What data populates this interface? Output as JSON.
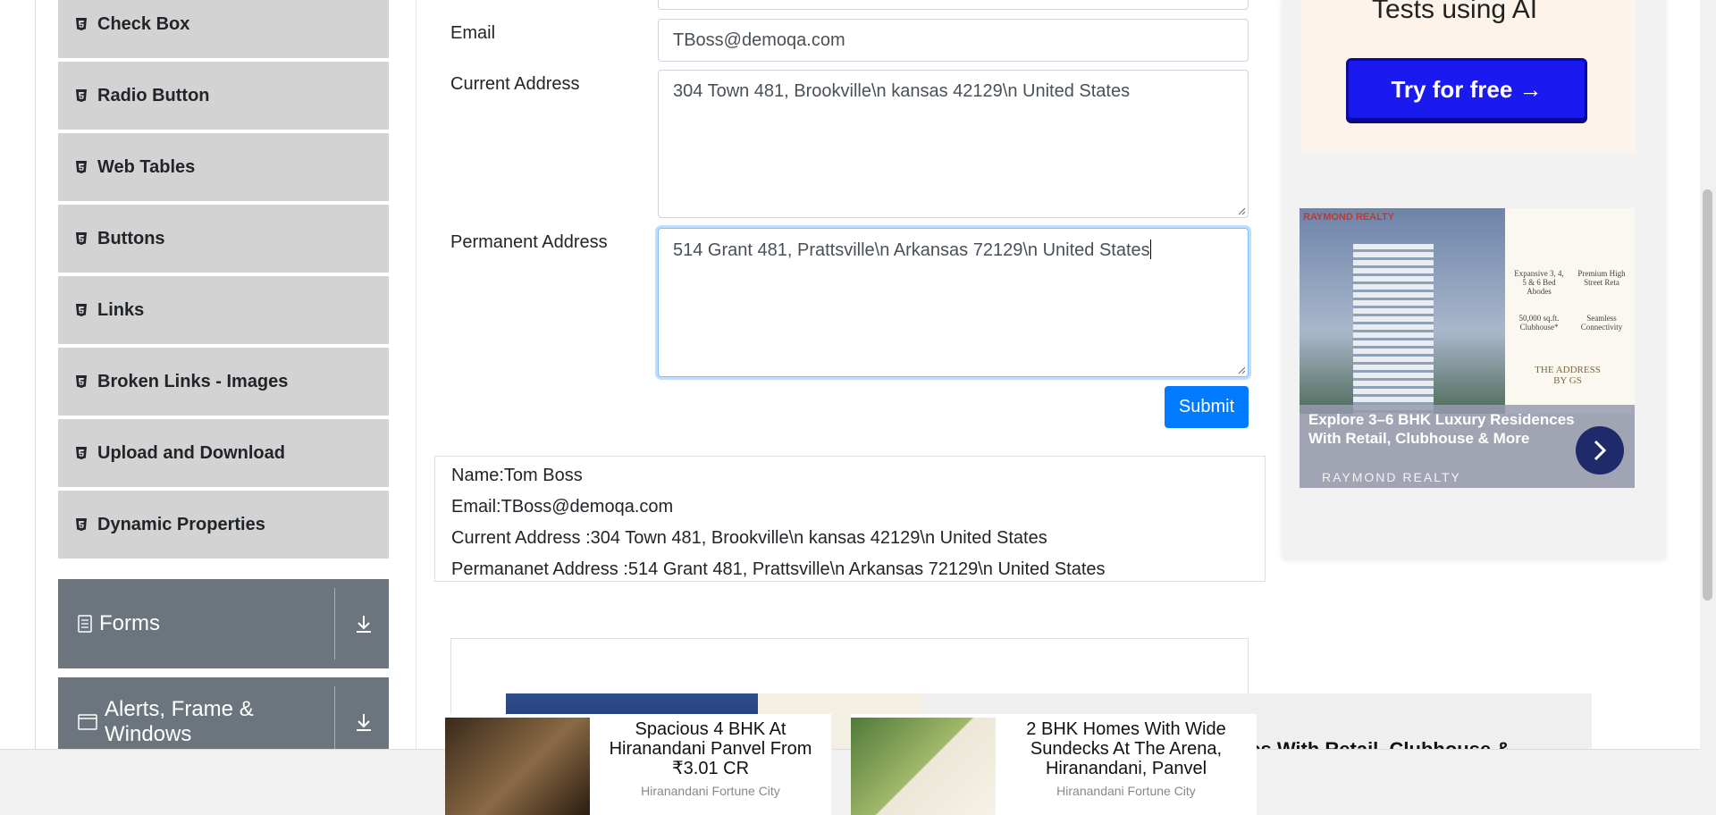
{
  "sidebar": {
    "items": [
      {
        "label": "Check Box"
      },
      {
        "label": "Radio Button"
      },
      {
        "label": "Web Tables"
      },
      {
        "label": "Buttons"
      },
      {
        "label": "Links"
      },
      {
        "label": "Broken Links - Images"
      },
      {
        "label": "Upload and Download"
      },
      {
        "label": "Dynamic Properties"
      }
    ],
    "groups": [
      {
        "label": "Forms"
      },
      {
        "label": "Alerts, Frame & Windows"
      }
    ]
  },
  "form": {
    "email": {
      "label": "Email",
      "value": "TBoss@demoqa.com"
    },
    "current_address": {
      "label": "Current Address",
      "value": "304 Town 481, Brookville\\n kansas 42129\\n United States"
    },
    "permanent_address": {
      "label": "Permanent Address",
      "value": "514 Grant 481, Prattsville\\n Arkansas 72129\\n United States"
    },
    "submit_label": "Submit"
  },
  "output": {
    "name": "Name:Tom Boss",
    "email": "Email:TBoss@demoqa.com",
    "current_address": "Current Address :304 Town 481, Brookville\\n kansas 42129\\n United States",
    "permanent_address": "Permananet Address :514 Grant 481, Prattsville\\n Arkansas 72129\\n United States"
  },
  "ads": {
    "ai": {
      "title": "Tests using AI",
      "button": "Try for free →"
    },
    "realty": {
      "brand": "RAYMOND REALTY",
      "feature1": "Expansive 3, 4, 5 & 6 Bed Abodes",
      "feature2": "Premium High Street Reta",
      "feature3": "50,000 sq.ft. Clubhouse*",
      "feature4": "Seamless Connectivity",
      "address": "THE ADDRESS BY GS",
      "headline": "Explore 3–6 BHK Luxury Residences With Retail, Clubhouse & More",
      "sponsor": "RAYMOND REALTY"
    },
    "strip_text": "ces With Retail, Clubhouse &",
    "bottom": [
      {
        "title": "Spacious 4 BHK At Hiranandani Panvel From ₹3.01 CR",
        "source": "Hiranandani Fortune City"
      },
      {
        "title": "2 BHK Homes With Wide Sundecks At The Arena, Hiranandani, Panvel",
        "source": "Hiranandani Fortune City"
      }
    ]
  },
  "colors": {
    "sidebar_item_bg": "#d3d3d3",
    "group_bg": "#6c757d",
    "primary": "#007bff",
    "ad_button": "#1a1af0"
  }
}
